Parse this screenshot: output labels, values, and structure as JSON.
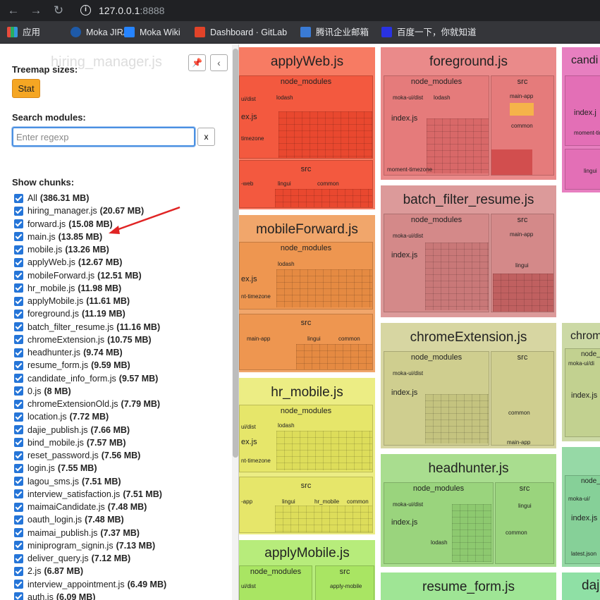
{
  "browser": {
    "url_host": "127.0.0.1",
    "url_port": ":8888",
    "bookmarks": [
      {
        "label": "应用",
        "color": "#e74c3c"
      },
      {
        "label": "Moka JIRA",
        "color": "#1e5aa8"
      },
      {
        "label": "Moka Wiki",
        "color": "#2684ff"
      },
      {
        "label": "Dashboard · GitLab",
        "color": "#e24329"
      },
      {
        "label": "腾讯企业邮箱",
        "color": "#3a7bd5"
      },
      {
        "label": "百度一下，你就知道",
        "color": "#2932e1"
      }
    ]
  },
  "sidebar": {
    "ghost_title": "hiring_manager.js",
    "treemap_sizes_label": "Treemap sizes:",
    "stat_button": "Stat",
    "search_label": "Search modules:",
    "search_placeholder": "Enter regexp",
    "clear_button": "x",
    "pin_icon": "📌",
    "collapse_icon": "‹",
    "show_chunks_label": "Show chunks:",
    "chunks": [
      {
        "name": "All",
        "size": "(386.31 MB)"
      },
      {
        "name": "hiring_manager.js",
        "size": "(20.67 MB)"
      },
      {
        "name": "forward.js",
        "size": "(15.08 MB)"
      },
      {
        "name": "main.js",
        "size": "(13.85 MB)"
      },
      {
        "name": "mobile.js",
        "size": "(13.26 MB)"
      },
      {
        "name": "applyWeb.js",
        "size": "(12.67 MB)"
      },
      {
        "name": "mobileForward.js",
        "size": "(12.51 MB)"
      },
      {
        "name": "hr_mobile.js",
        "size": "(11.98 MB)"
      },
      {
        "name": "applyMobile.js",
        "size": "(11.61 MB)"
      },
      {
        "name": "foreground.js",
        "size": "(11.19 MB)"
      },
      {
        "name": "batch_filter_resume.js",
        "size": "(11.16 MB)"
      },
      {
        "name": "chromeExtension.js",
        "size": "(10.75 MB)"
      },
      {
        "name": "headhunter.js",
        "size": "(9.74 MB)"
      },
      {
        "name": "resume_form.js",
        "size": "(9.59 MB)"
      },
      {
        "name": "candidate_info_form.js",
        "size": "(9.57 MB)"
      },
      {
        "name": "0.js",
        "size": "(8 MB)"
      },
      {
        "name": "chromeExtensionOld.js",
        "size": "(7.79 MB)"
      },
      {
        "name": "location.js",
        "size": "(7.72 MB)"
      },
      {
        "name": "dajie_publish.js",
        "size": "(7.66 MB)"
      },
      {
        "name": "bind_mobile.js",
        "size": "(7.57 MB)"
      },
      {
        "name": "reset_password.js",
        "size": "(7.56 MB)"
      },
      {
        "name": "login.js",
        "size": "(7.55 MB)"
      },
      {
        "name": "lagou_sms.js",
        "size": "(7.51 MB)"
      },
      {
        "name": "interview_satisfaction.js",
        "size": "(7.51 MB)"
      },
      {
        "name": "maimaiCandidate.js",
        "size": "(7.48 MB)"
      },
      {
        "name": "oauth_login.js",
        "size": "(7.48 MB)"
      },
      {
        "name": "maimai_publish.js",
        "size": "(7.37 MB)"
      },
      {
        "name": "miniprogram_signin.js",
        "size": "(7.13 MB)"
      },
      {
        "name": "deliver_query.js",
        "size": "(7.12 MB)"
      },
      {
        "name": "2.js",
        "size": "(6.87 MB)"
      },
      {
        "name": "interview_appointment.js",
        "size": "(6.49 MB)"
      },
      {
        "name": "auth.js",
        "size": "(6.09 MB)"
      }
    ]
  },
  "treemap": {
    "tiles": [
      {
        "title": "applyWeb.js",
        "color": "#f77b63",
        "sub_labels": [
          "node_modules",
          "src",
          "ui/dist",
          "ex.js",
          "lodash",
          "timezone",
          "lingui",
          "common",
          "-web"
        ]
      },
      {
        "title": "foreground.js",
        "color": "#ea8a8a",
        "sub_labels": [
          "node_modules",
          "src",
          "moka-ui/dist",
          "index.js",
          "lodash",
          "main-app",
          "common",
          "lingui",
          "moment-timezone"
        ]
      },
      {
        "title": "candi",
        "color": "#e77fc0",
        "sub_labels": [
          "index.j",
          "moment-time",
          "lingui"
        ]
      },
      {
        "title": "mobileForward.js",
        "color": "#f1a66b",
        "sub_labels": [
          "node_modules",
          "src",
          "lodash",
          "ex.js",
          "nt-timezone",
          "main-app",
          "lingui",
          "common"
        ]
      },
      {
        "title": "batch_filter_resume.js",
        "color": "#dc9a9a",
        "sub_labels": [
          "node_modules",
          "src",
          "moka-ui/dist",
          "index.js",
          "main-app",
          "lingui",
          "common"
        ]
      },
      {
        "title": "hr_mobile.js",
        "color": "#eced84",
        "sub_labels": [
          "node_modules",
          "src",
          "ui/dist",
          "lodash",
          "ex.js",
          "nt-timezone",
          "-app",
          "lingui",
          "hr_mobile",
          "common"
        ]
      },
      {
        "title": "chromeExtension.js",
        "color": "#d7d6a2",
        "sub_labels": [
          "node_modules",
          "src",
          "moka-ui/dist",
          "index.js",
          "lodash",
          "common",
          "main-app"
        ]
      },
      {
        "title": "chrom",
        "color": "#ccd9a5",
        "sub_labels": [
          "node_m",
          "moka-ui/di",
          "index.js"
        ]
      },
      {
        "title": "applyMobile.js",
        "color": "#b7ec7b",
        "sub_labels": [
          "node_modules",
          "src",
          "ui/dist",
          "apply-mobile"
        ]
      },
      {
        "title": "headhunter.js",
        "color": "#a9dd8f",
        "sub_labels": [
          "node_modules",
          "src",
          "moka-ui/dist",
          "index.js",
          "lodash",
          "lingui",
          "common"
        ]
      },
      {
        "title": "",
        "color": "#96d9a6",
        "sub_labels": [
          "node_",
          "moka-ui/",
          "index.js",
          "latest.json"
        ]
      },
      {
        "title": "resume_form.js",
        "color": "#9fe595",
        "sub_labels": []
      },
      {
        "title": "daj",
        "color": "#8fe0a5",
        "sub_labels": []
      }
    ]
  }
}
